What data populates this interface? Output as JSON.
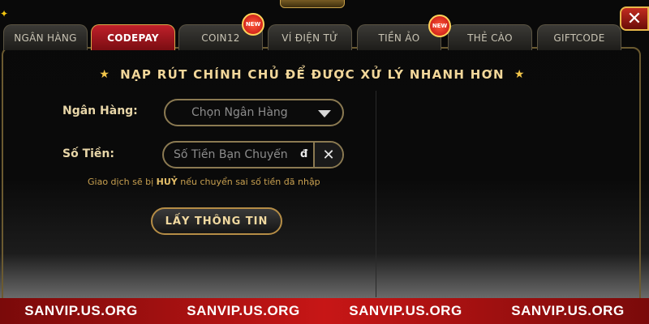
{
  "tabs": [
    {
      "label": "NGÂN HÀNG",
      "active": false
    },
    {
      "label": "CODEPAY",
      "active": true
    },
    {
      "label": "COIN12",
      "active": false,
      "badge": "NEW"
    },
    {
      "label": "VÍ ĐIỆN TỬ",
      "active": false
    },
    {
      "label": "TIỀN ẢO",
      "active": false,
      "badge": "NEW"
    },
    {
      "label": "THẺ CÀO",
      "active": false
    },
    {
      "label": "GIFTCODE",
      "active": false
    }
  ],
  "icons": {
    "close": "close-icon",
    "star": "star-icon",
    "caret": "chevron-down-icon",
    "clear": "close-icon"
  },
  "headline": "NẠP RÚT CHÍNH CHỦ ĐỂ ĐƯỢC XỬ LÝ NHANH HƠN",
  "form": {
    "bank_label": "Ngân Hàng:",
    "bank_placeholder": "Chọn Ngân Hàng",
    "amount_label": "Số Tiền:",
    "amount_placeholder": "Số Tiền Bạn Chuyển",
    "currency": "đ",
    "note_prefix": "Giao dịch sẽ bị ",
    "note_emphasis": "HUỶ",
    "note_suffix": " nếu chuyển sai số tiền đã nhập",
    "fetch_button": "LẤY THÔNG TIN"
  },
  "watermark": [
    "SANVIP.US.ORG",
    "SANVIP.US.ORG",
    "SANVIP.US.ORG",
    "SANVIP.US.ORG"
  ],
  "colors": {
    "accent_red": "#c0202a",
    "gold": "#d9a84a",
    "text_gold": "#f2d79a"
  }
}
